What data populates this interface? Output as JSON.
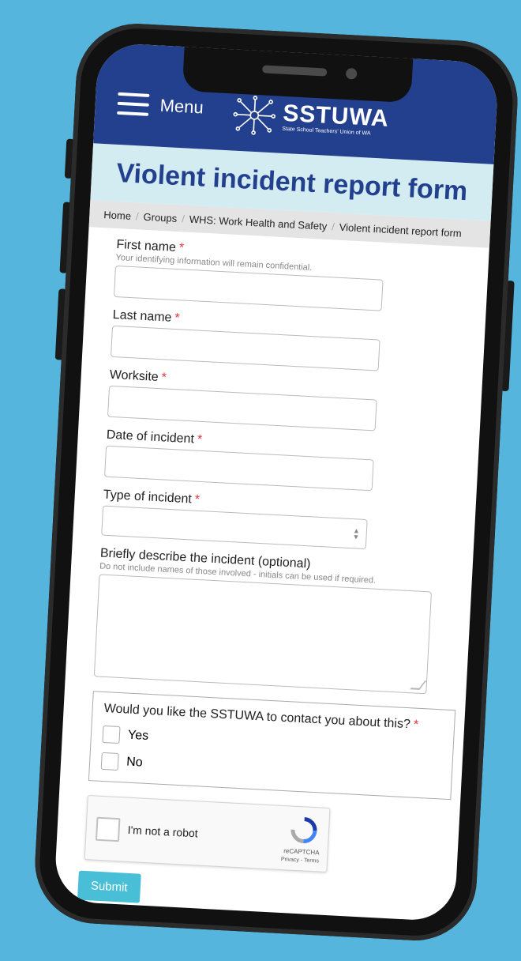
{
  "header": {
    "menu_label": "Menu",
    "logo_name": "SSTUWA",
    "logo_sub": "State School Teachers' Union of WA"
  },
  "page_title": "Violent incident report form",
  "breadcrumb": [
    "Home",
    "Groups",
    "WHS: Work Health and Safety",
    "Violent incident report form"
  ],
  "form": {
    "first_name": {
      "label": "First name",
      "required": "*",
      "hint": "Your identifying information will remain confidential.",
      "value": ""
    },
    "last_name": {
      "label": "Last name",
      "required": "*",
      "value": ""
    },
    "worksite": {
      "label": "Worksite",
      "required": "*",
      "value": ""
    },
    "date": {
      "label": "Date of incident",
      "required": "*",
      "value": ""
    },
    "type": {
      "label": "Type of incident",
      "required": "*",
      "value": ""
    },
    "description": {
      "label": "Briefly describe the incident (optional)",
      "hint": "Do not include names of those involved - initials can be used if required.",
      "value": ""
    },
    "contact": {
      "question": "Would you like the SSTUWA to contact you about this?",
      "required": "*",
      "options": [
        "Yes",
        "No"
      ]
    },
    "captcha": {
      "label": "I'm not a robot",
      "brand": "reCAPTCHA",
      "terms": "Privacy - Terms"
    },
    "submit_label": "Submit"
  },
  "colors": {
    "header": "#23408e",
    "title_band": "#d3ecf1",
    "submit": "#48bfd6",
    "background": "#56b5dc"
  }
}
